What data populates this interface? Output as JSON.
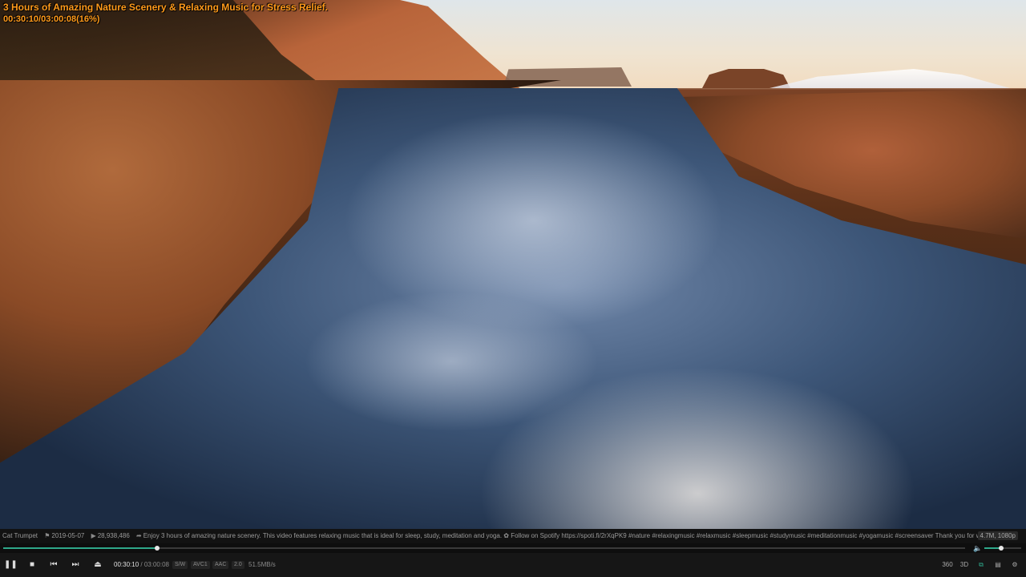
{
  "overlay": {
    "title": "3 Hours of Amazing Nature Scenery & Relaxing Music for Stress Relief.",
    "progress": "00:30:10/03:00:08(16%)"
  },
  "info": {
    "channel": "Cat Trumpet",
    "date": "2019-05-07",
    "views": "28,938,486",
    "description": "Enjoy 3 hours of amazing nature scenery. This video features relaxing music that is ideal for sleep, study, meditation and yoga.  ✿ Follow on Spotify https://spoti.fi/2rXqPK9  #nature #relaxingmusic #relaxmusic #sleepmusic #studymusic #meditationmusic #yogamusic #screensaver   Thank you for watching! I love to create video",
    "size": "4.7M, 1080p",
    "icons": {
      "channel": "flag-icon",
      "views": "play-icon",
      "share": "share-icon"
    }
  },
  "seek": {
    "played_fraction": 0.16
  },
  "volume": {
    "level_fraction": 0.45
  },
  "controls": {
    "current_time": "00:30:10",
    "separator": "/",
    "duration": "03:00:08",
    "tags": [
      "S/W",
      "AVC1",
      "AAC",
      "2.0"
    ],
    "bitrate": "51.5MB/s",
    "icons": {
      "play_pause": "pause-icon",
      "stop": "stop-icon",
      "prev": "previous-icon",
      "next": "next-icon",
      "open": "eject-icon",
      "vr360": "360-icon",
      "threed": "3d-icon",
      "capture": "capture-icon",
      "playlist": "playlist-icon",
      "settings": "gear-icon"
    },
    "vr_label": "360",
    "threed_label": "3D"
  },
  "colors": {
    "accent": "#2ea88a",
    "title": "#ff9a1a"
  }
}
